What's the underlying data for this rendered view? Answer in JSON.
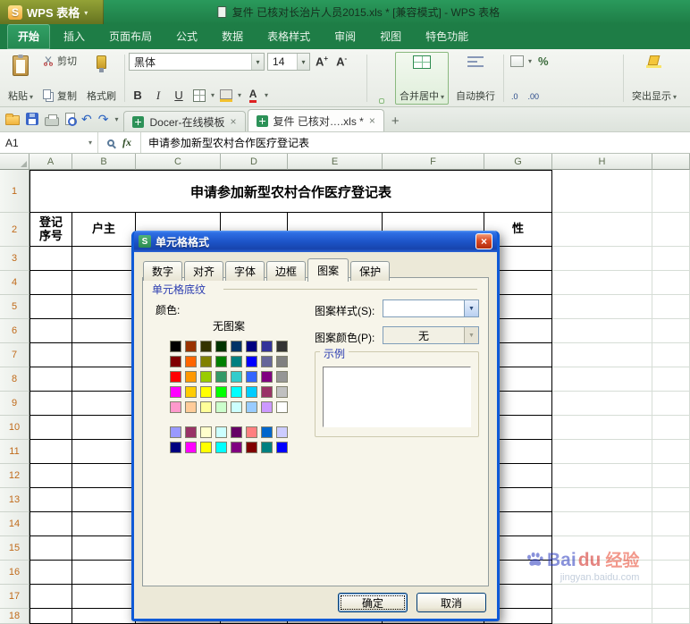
{
  "theme": {
    "wps_green": "#1e7d46",
    "menu_olive": "#7c8b2a",
    "ribbon_bg": "#eef1ec",
    "dialog_title_blue": "#1d55c9",
    "xp_face": "#ece9d8",
    "close_red": "#da4a24",
    "table_border": "#000000",
    "row_number_color": "#c06a1a"
  },
  "titlebar": {
    "menu_label": "WPS 表格",
    "doc_title": "复件 已核对长治片人员2015.xls * [兼容模式] - WPS 表格"
  },
  "ribbon": {
    "tabs": [
      "开始",
      "插入",
      "页面布局",
      "公式",
      "数据",
      "表格样式",
      "审阅",
      "视图",
      "特色功能"
    ],
    "active_tab": "开始"
  },
  "toolbar": {
    "paste": "粘贴",
    "cut": "剪切",
    "copy": "复制",
    "format_painter": "格式刷",
    "font_name": "黑体",
    "font_size": "14",
    "bold": "B",
    "italic": "I",
    "underline": "U",
    "merge_center": "合并居中",
    "wrap_text": "自动换行",
    "highlight": "突出显示"
  },
  "quickbar": {
    "doc_tabs": [
      {
        "label": "Docer-在线模板",
        "active": false
      },
      {
        "label": "复件 已核对….xls *",
        "active": true
      }
    ]
  },
  "formula_bar": {
    "name_box": "A1",
    "content": "申请参加新型农村合作医疗登记表"
  },
  "sheet": {
    "column_letters": [
      "A",
      "B",
      "C",
      "D",
      "E",
      "F",
      "G",
      "H"
    ],
    "row_numbers": [
      "1",
      "2",
      "3",
      "4",
      "5",
      "6",
      "7",
      "8",
      "9",
      "10",
      "11",
      "12",
      "13",
      "14",
      "15",
      "16",
      "17",
      "18"
    ],
    "cells": {
      "title": "申请参加新型农村合作医疗登记表",
      "a2": "登记\n序号",
      "b2": "户主",
      "g2": "性"
    }
  },
  "dialog": {
    "title": "单元格格式",
    "tabs": [
      "数字",
      "对齐",
      "字体",
      "边框",
      "图案",
      "保护"
    ],
    "active_tab": "图案",
    "shading_group_label": "单元格底纹",
    "color_label": "颜色:",
    "no_pattern_label": "无图案",
    "pattern_style_label": "图案样式(S):",
    "pattern_style_value": "",
    "pattern_color_label": "图案颜色(P):",
    "pattern_color_value": "无",
    "sample_label": "示例",
    "ok_label": "确定",
    "cancel_label": "取消",
    "palette_main": [
      "#000000",
      "#993300",
      "#333300",
      "#003300",
      "#003366",
      "#000080",
      "#333399",
      "#333333",
      "#800000",
      "#FF6600",
      "#808000",
      "#008000",
      "#008080",
      "#0000FF",
      "#666699",
      "#808080",
      "#FF0000",
      "#FF9900",
      "#99CC00",
      "#339966",
      "#33CCCC",
      "#3366FF",
      "#800080",
      "#969696",
      "#FF00FF",
      "#FFCC00",
      "#FFFF00",
      "#00FF00",
      "#00FFFF",
      "#00CCFF",
      "#993366",
      "#C0C0C0",
      "#FF99CC",
      "#FFCC99",
      "#FFFF99",
      "#CCFFCC",
      "#CCFFFF",
      "#99CCFF",
      "#CC99FF",
      "#FFFFFF"
    ],
    "palette_extra": [
      "#9999FF",
      "#993366",
      "#FFFFCC",
      "#CCFFFF",
      "#660066",
      "#FF8080",
      "#0066CC",
      "#CCCCFF",
      "#000080",
      "#FF00FF",
      "#FFFF00",
      "#00FFFF",
      "#800080",
      "#800000",
      "#008080",
      "#0000FF"
    ]
  },
  "watermark": {
    "bai": "Bai",
    "du": "du",
    "suffix": "经验",
    "url": "jingyan.baidu.com"
  },
  "icons": {
    "caret": "▾",
    "dropdown_arrow": "▼",
    "close": "×",
    "plus": "+",
    "undo": "↶",
    "redo": "↷",
    "percent": "%",
    "letter_a": "A",
    "sup_plus": "+",
    "sup_minus": "-",
    "decimal_one": ".0",
    "decimal_two": ".00",
    "fx": "fx",
    "wps_s": "S"
  }
}
